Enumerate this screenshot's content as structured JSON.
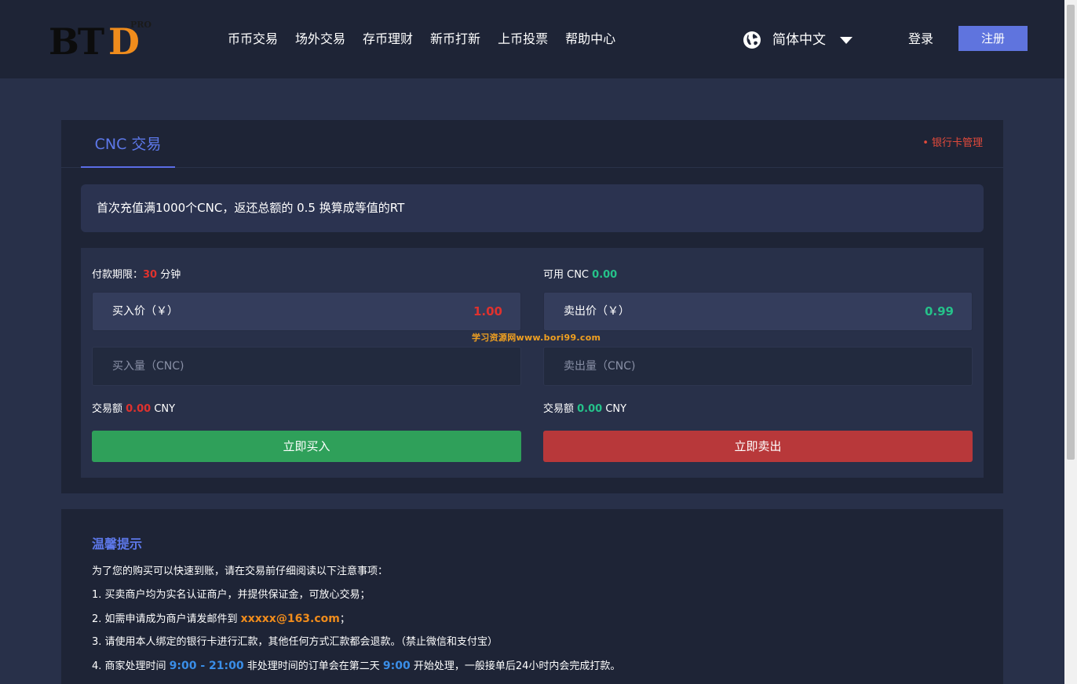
{
  "header": {
    "logo": {
      "bt": "BT",
      "d": "D",
      "pro": "PRO"
    },
    "nav": [
      "币币交易",
      "场外交易",
      "存币理财",
      "新币打新",
      "上币投票",
      "帮助中心"
    ],
    "language": "简体中文",
    "login": "登录",
    "register": "注册"
  },
  "trade": {
    "tab": "CNC 交易",
    "bank_link": "• 银行卡管理",
    "notice": "首次充值满1000个CNC，返还总额的 0.5 换算成等值的RT",
    "buy": {
      "deadline_label": "付款期限：",
      "deadline_value": "30",
      "deadline_unit": " 分钟",
      "price_label": "买入价（￥）",
      "price_value": "1.00",
      "qty_placeholder": "买入量（CNC)",
      "amount_label": "交易额 ",
      "amount_value": "0.00",
      "amount_unit": " CNY",
      "button": "立即买入"
    },
    "sell": {
      "available_label": "可用 CNC ",
      "available_value": "0.00",
      "price_label": "卖出价（￥）",
      "price_value": "0.99",
      "qty_placeholder": "卖出量（CNC)",
      "amount_label": "交易额 ",
      "amount_value": "0.00",
      "amount_unit": " CNY",
      "button": "立即卖出"
    }
  },
  "watermark": "学习资源网www.bori99.com",
  "tips": {
    "title": "温馨提示",
    "intro": "为了您的购买可以快速到账，请在交易前仔细阅读以下注意事项：",
    "item1": "1. 买卖商户均为实名认证商户，并提供保证金，可放心交易；",
    "item2_pre": "2. 如需申请成为商户请发邮件到 ",
    "item2_email": "xxxxx@163.com",
    "item2_post": "；",
    "item3": "3. 请使用本人绑定的银行卡进行汇款，其他任何方式汇款都会退款。（禁止微信和支付宝）",
    "item4_pre": "4. 商家处理时间 ",
    "item4_time": "9:00 - 21:00",
    "item4_mid": " 非处理时间的订单会在第二天 ",
    "item4_start": "9:00",
    "item4_post": " 开始处理，一般接单后24小时内会完成打款。"
  },
  "colors": {
    "accent": "#5f74de",
    "buy_green": "#2fa05a",
    "sell_red": "#b8383a",
    "price_red": "#e0322e",
    "price_green": "#25c28a",
    "email_orange": "#f08c1c",
    "time_blue": "#3a8ee8"
  }
}
